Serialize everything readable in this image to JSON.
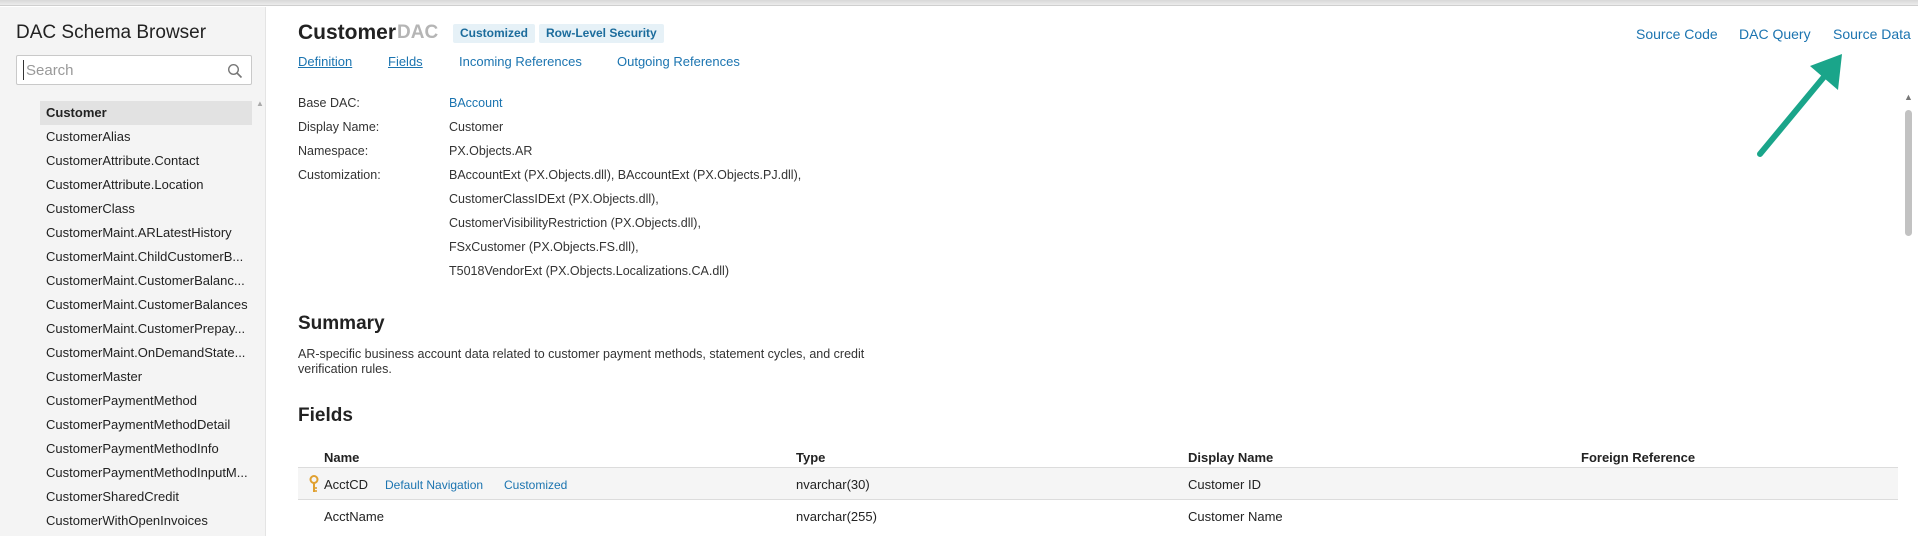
{
  "sidebar": {
    "title": "DAC Schema Browser",
    "search_placeholder": "Search",
    "items": [
      "Customer",
      "CustomerAlias",
      "CustomerAttribute.Contact",
      "CustomerAttribute.Location",
      "CustomerClass",
      "CustomerMaint.ARLatestHistory",
      "CustomerMaint.ChildCustomerB...",
      "CustomerMaint.CustomerBalanc...",
      "CustomerMaint.CustomerBalances",
      "CustomerMaint.CustomerPrepay...",
      "CustomerMaint.OnDemandState...",
      "CustomerMaster",
      "CustomerPaymentMethod",
      "CustomerPaymentMethodDetail",
      "CustomerPaymentMethodInfo",
      "CustomerPaymentMethodInputM...",
      "CustomerSharedCredit",
      "CustomerWithOpenInvoices"
    ],
    "selected": "Customer"
  },
  "header": {
    "title": "Customer",
    "subtitle": "DAC",
    "badges": [
      "Customized",
      "Row-Level Security"
    ],
    "tabs": [
      "Definition",
      "Fields",
      "Incoming References",
      "Outgoing References"
    ],
    "links": [
      "Source Code",
      "DAC Query",
      "Source Data"
    ]
  },
  "properties": {
    "base_dac_label": "Base DAC:",
    "base_dac_value": "BAccount",
    "display_name_label": "Display Name:",
    "display_name_value": "Customer",
    "namespace_label": "Namespace:",
    "namespace_value": "PX.Objects.AR",
    "customization_label": "Customization:",
    "customization_values": [
      "BAccountExt (PX.Objects.dll),  BAccountExt (PX.Objects.PJ.dll),",
      "CustomerClassIDExt (PX.Objects.dll),",
      "CustomerVisibilityRestriction (PX.Objects.dll),",
      "FSxCustomer (PX.Objects.FS.dll),",
      "T5018VendorExt (PX.Objects.Localizations.CA.dll)"
    ]
  },
  "summary": {
    "heading": "Summary",
    "text": "AR-specific business account data related to customer payment methods, statement cycles, and credit verification rules."
  },
  "fields": {
    "heading": "Fields",
    "columns": [
      "Name",
      "Type",
      "Display Name",
      "Foreign Reference"
    ],
    "rows": [
      {
        "name": "AcctCD",
        "tags": [
          "Default Navigation",
          "Customized"
        ],
        "type": "nvarchar(30)",
        "display": "Customer ID",
        "foreign": ""
      },
      {
        "name": "AcctName",
        "tags": [],
        "type": "nvarchar(255)",
        "display": "Customer Name",
        "foreign": ""
      }
    ]
  },
  "colors": {
    "link": "#1b74b0",
    "annotation_arrow": "#1aa58a"
  },
  "icons": [
    "search-icon",
    "key-icon",
    "annotation-arrow"
  ]
}
